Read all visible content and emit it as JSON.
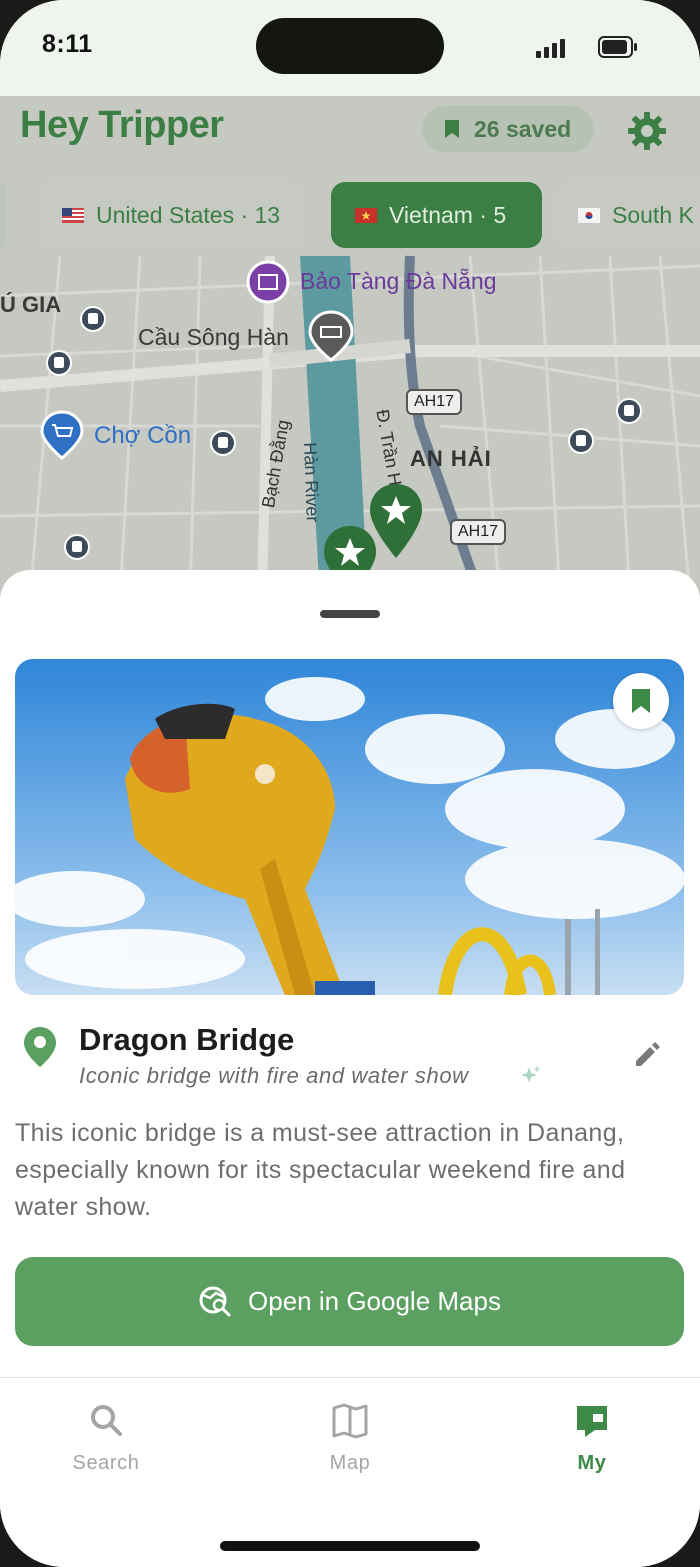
{
  "status_bar": {
    "time": "8:11"
  },
  "header": {
    "logo_text": "Hey Tripper",
    "saved_label": "26 saved",
    "settings_icon": "gear-icon"
  },
  "country_chips": [
    {
      "label": "United States · 13",
      "flag": "us"
    },
    {
      "label": "Vietnam · 5",
      "flag": "vn",
      "active": true
    },
    {
      "label": "South K",
      "flag": "kr"
    }
  ],
  "map_labels": {
    "museum": "Bảo Tàng Đà Nẵng",
    "area_gia": "Ú GIA",
    "bridge_han": "Cầu Sông Hàn",
    "market": "Chợ Cồn",
    "road_bach_dang": "Bạch Đằng",
    "river": "Hàn River",
    "road_tran": "Đ. Trần H",
    "district": "AN HẢI",
    "highway_1": "AH17",
    "highway_2": "AH17"
  },
  "place": {
    "title": "Dragon Bridge",
    "subtitle": "Iconic bridge with fire and water show",
    "description": "This iconic bridge is a must-see attraction in Danang, especially known for its spectacular weekend fire and water show.",
    "open_maps_label": "Open in Google Maps"
  },
  "tabs": [
    {
      "label": "Search",
      "icon": "search-icon"
    },
    {
      "label": "Map",
      "icon": "map-icon"
    },
    {
      "label": "My",
      "icon": "my-bookmark-icon",
      "active": true
    }
  ],
  "colors": {
    "brand_green": "#3c7f45",
    "button_green": "#5b9f61",
    "active_tab": "#3c8a45"
  }
}
